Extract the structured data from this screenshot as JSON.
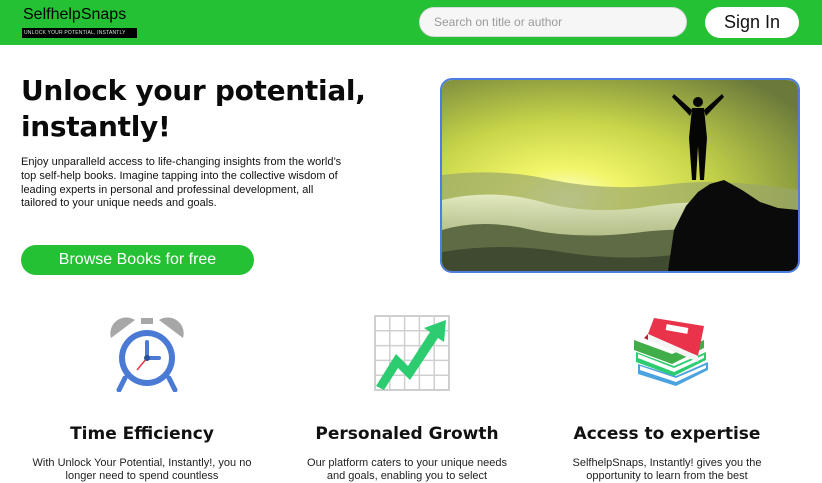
{
  "header": {
    "logo_name": "SelfhelpSnaps",
    "logo_tagline": "UNLOCK YOUR POTENTIAL, INSTANTLY",
    "search_placeholder": "Search on title or author",
    "sign_in_label": "Sign In"
  },
  "hero": {
    "title": "Unlock your potential, instantly!",
    "description": "Enjoy unparalleld access to life-changing insights from the world’s top self-help books. Imagine tapping into the collective wisdom of leading experts in personal and professinal development, all tailored to your unique needs and goals.",
    "cta_label": "Browse Books for free",
    "image_icon": "person-on-mountain-peak-photo"
  },
  "features": [
    {
      "icon": "alarm-clock-icon",
      "title": "Time Efficiency",
      "description": "With Unlock Your Potential, Instantly!, you no longer need to spend countless"
    },
    {
      "icon": "growth-chart-icon",
      "title": "Personaled Growth",
      "description": "Our platform caters to your unique needs and goals, enabling you to select"
    },
    {
      "icon": "books-stack-icon",
      "title": "Access to expertise",
      "description": "SelfhelpSnaps, Instantly! gives you the opportunity to learn from the best"
    }
  ],
  "colors": {
    "brand_green": "#23c133",
    "image_border": "#4d7de0",
    "clock_blue": "#4a7ad3",
    "chart_green": "#2ecc71",
    "book_red": "#e8334a"
  }
}
